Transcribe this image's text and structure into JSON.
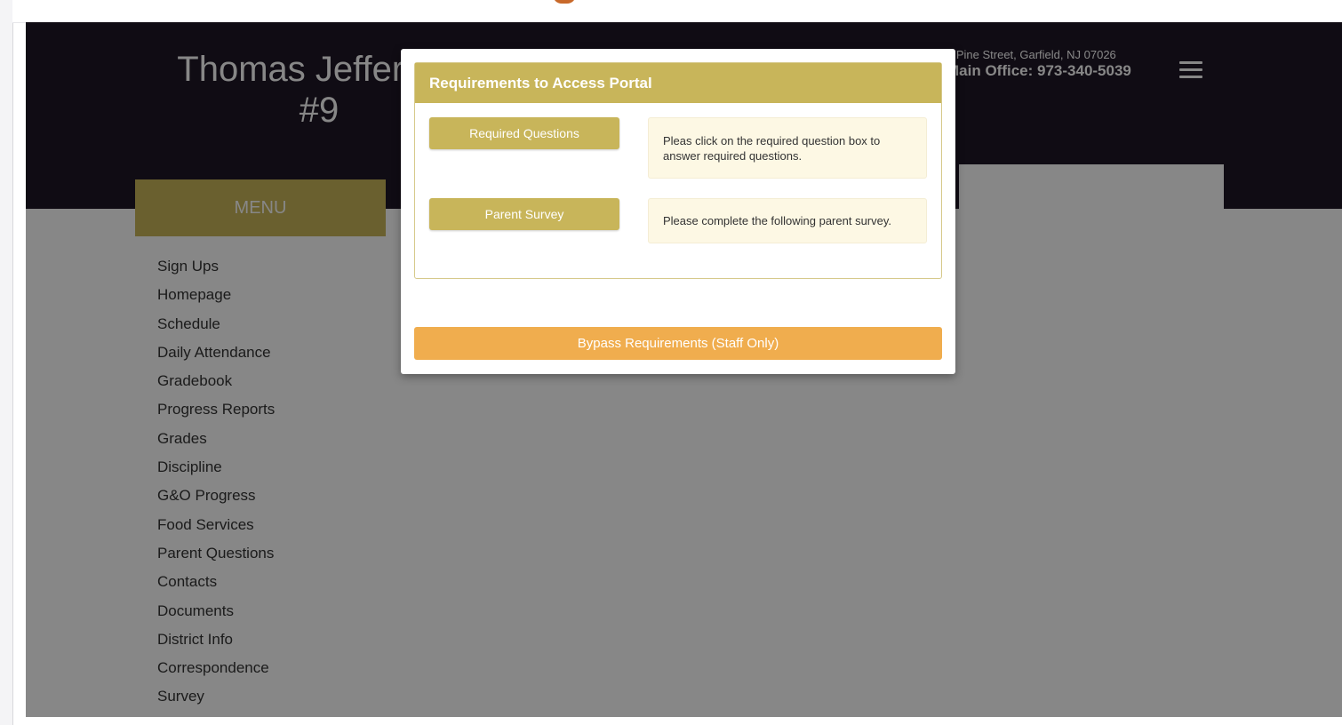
{
  "header": {
    "school_name": "Thomas Jefferson\n#9",
    "address": "1 Pine Street, Garfield, NJ 07026",
    "phone": "Main Office: 973-340-5039"
  },
  "sidebar": {
    "menu_title": "MENU",
    "items": [
      "Sign Ups",
      "Homepage",
      "Schedule",
      "Daily Attendance",
      "Gradebook",
      "Progress Reports",
      "Grades",
      "Discipline",
      "G&O Progress",
      "Food Services",
      "Parent Questions",
      "Contacts",
      "Documents",
      "District Info",
      "Correspondence",
      "Survey"
    ]
  },
  "modal": {
    "title": "Requirements to Access Portal",
    "requirements": [
      {
        "button": "Required Questions",
        "description": "Pleas click on the required question box to answer required questions."
      },
      {
        "button": "Parent Survey",
        "description": "Please complete the following parent survey."
      }
    ],
    "bypass_label": "Bypass Requirements (Staff Only)"
  },
  "colors": {
    "header_bg": "#1f1726",
    "gold": "#c8b55a",
    "bypass_orange": "#f0ad4e",
    "desc_bg": "#fdf8e4"
  }
}
